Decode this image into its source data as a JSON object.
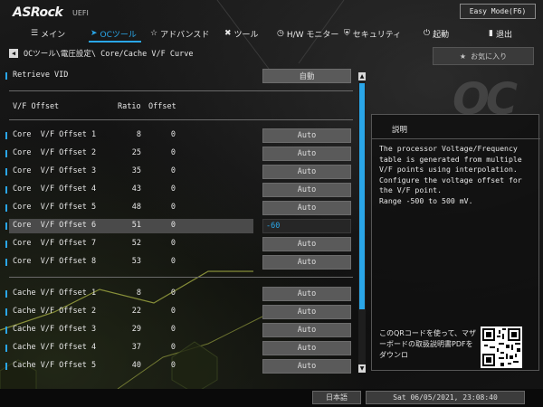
{
  "header": {
    "logo": "ASRock",
    "logo_sub": "UEFI",
    "easy_mode_label": "Easy Mode(F6)"
  },
  "nav": {
    "items": [
      {
        "label": "メイン",
        "icon": "menu-icon",
        "glyph": "☰"
      },
      {
        "label": "OCツール",
        "icon": "rocket-icon",
        "glyph": "➤"
      },
      {
        "label": "アドバンスド",
        "icon": "star-icon",
        "glyph": "☆"
      },
      {
        "label": "ツール",
        "icon": "tools-icon",
        "glyph": "✖"
      },
      {
        "label": "H/W モニター",
        "icon": "monitor-icon",
        "glyph": "◷"
      },
      {
        "label": "セキュリティ",
        "icon": "shield-icon",
        "glyph": "⛨"
      },
      {
        "label": "起動",
        "icon": "power-icon",
        "glyph": "⏻"
      },
      {
        "label": "退出",
        "icon": "exit-icon",
        "glyph": "▮"
      }
    ],
    "active_index": 1
  },
  "breadcrumb": "OCツール\\電圧設定\\ Core/Cache V/F Curve",
  "favorite_label": "お気に入り",
  "retrieve": {
    "label": "Retrieve VID",
    "value": "自動"
  },
  "columns": {
    "name": "V/F Offset",
    "ratio": "Ratio",
    "offset": "Offset"
  },
  "core_rows": [
    {
      "label": "Core  V/F Offset 1",
      "ratio": "8",
      "offset": "0",
      "value": "Auto"
    },
    {
      "label": "Core  V/F Offset 2",
      "ratio": "25",
      "offset": "0",
      "value": "Auto"
    },
    {
      "label": "Core  V/F Offset 3",
      "ratio": "35",
      "offset": "0",
      "value": "Auto"
    },
    {
      "label": "Core  V/F Offset 4",
      "ratio": "43",
      "offset": "0",
      "value": "Auto"
    },
    {
      "label": "Core  V/F Offset 5",
      "ratio": "48",
      "offset": "0",
      "value": "Auto"
    },
    {
      "label": "Core  V/F Offset 6",
      "ratio": "51",
      "offset": "0",
      "value": "-60"
    },
    {
      "label": "Core  V/F Offset 7",
      "ratio": "52",
      "offset": "0",
      "value": "Auto"
    },
    {
      "label": "Core  V/F Offset 8",
      "ratio": "53",
      "offset": "0",
      "value": "Auto"
    }
  ],
  "cache_rows": [
    {
      "label": "Cache V/F Offset 1",
      "ratio": "8",
      "offset": "0",
      "value": "Auto"
    },
    {
      "label": "Cache V/F Offset 2",
      "ratio": "22",
      "offset": "0",
      "value": "Auto"
    },
    {
      "label": "Cache V/F Offset 3",
      "ratio": "29",
      "offset": "0",
      "value": "Auto"
    },
    {
      "label": "Cache V/F Offset 4",
      "ratio": "37",
      "offset": "0",
      "value": "Auto"
    },
    {
      "label": "Cache V/F Offset 5",
      "ratio": "40",
      "offset": "0",
      "value": "Auto"
    }
  ],
  "help": {
    "title": "説明",
    "text": "The processor Voltage/Frequency table is generated from multiple V/F points using interpolation. Configure the voltage offset for the V/F point.\nRange -500 to 500 mV.",
    "qr_text": "このQRコードを使って、マザーボードの取扱説明書PDFをダウンロ"
  },
  "footer": {
    "language": "日本語",
    "datetime": "Sat 06/05/2021, 23:08:40"
  },
  "colors": {
    "accent": "#2aa6e8",
    "button": "#5a5a5a",
    "background": "#101010"
  }
}
